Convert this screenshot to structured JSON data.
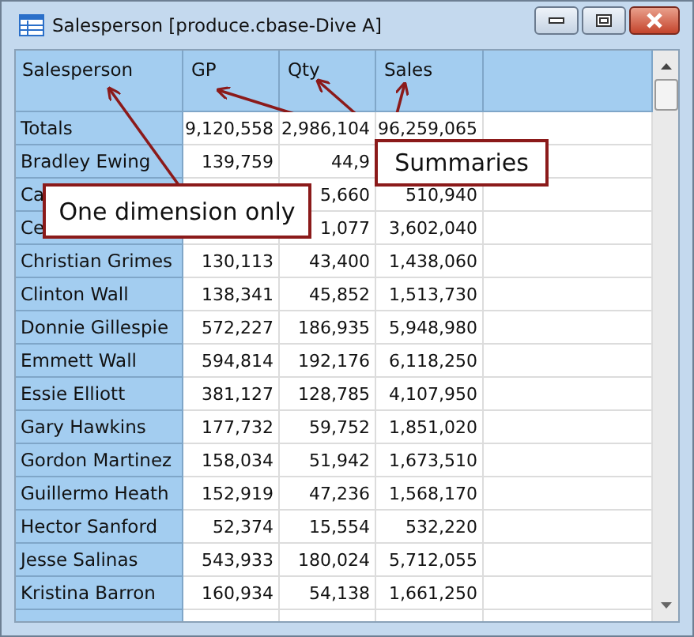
{
  "window": {
    "title": "Salesperson [produce.cbase-Dive A]"
  },
  "table": {
    "columns": [
      "Salesperson",
      "GP",
      "Qty",
      "Sales"
    ],
    "rows": [
      {
        "cells": [
          "Totals",
          "9,120,558",
          "2,986,104",
          "96,259,065"
        ]
      },
      {
        "cells": [
          "Bradley Ewing",
          "139,759",
          "44,9",
          ""
        ]
      },
      {
        "cells": [
          "Ca",
          "",
          "5,660",
          "510,940"
        ]
      },
      {
        "cells": [
          "Ce",
          "",
          "1,077",
          "3,602,040"
        ]
      },
      {
        "cells": [
          "Christian Grimes",
          "130,113",
          "43,400",
          "1,438,060"
        ]
      },
      {
        "cells": [
          "Clinton Wall",
          "138,341",
          "45,852",
          "1,513,730"
        ]
      },
      {
        "cells": [
          "Donnie Gillespie",
          "572,227",
          "186,935",
          "5,948,980"
        ]
      },
      {
        "cells": [
          "Emmett Wall",
          "594,814",
          "192,176",
          "6,118,250"
        ]
      },
      {
        "cells": [
          "Essie Elliott",
          "381,127",
          "128,785",
          "4,107,950"
        ]
      },
      {
        "cells": [
          "Gary Hawkins",
          "177,732",
          "59,752",
          "1,851,020"
        ]
      },
      {
        "cells": [
          "Gordon Martinez",
          "158,034",
          "51,942",
          "1,673,510"
        ]
      },
      {
        "cells": [
          "Guillermo Heath",
          "152,919",
          "47,236",
          "1,568,170"
        ]
      },
      {
        "cells": [
          "Hector Sanford",
          "52,374",
          "15,554",
          "532,220"
        ]
      },
      {
        "cells": [
          "Jesse Salinas",
          "543,933",
          "180,024",
          "5,712,055"
        ]
      },
      {
        "cells": [
          "Kristina Barron",
          "160,934",
          "54,138",
          "1,661,250"
        ]
      }
    ]
  },
  "callouts": [
    {
      "text": "Summaries"
    },
    {
      "text": "One dimension only"
    }
  ]
}
